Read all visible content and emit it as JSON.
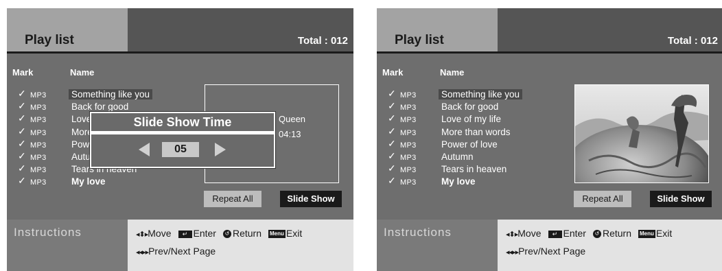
{
  "screens": [
    {
      "title": "Play list",
      "total": "Total : 012",
      "columns": {
        "mark": "Mark",
        "name": "Name"
      },
      "tracks": [
        {
          "format": "MP3",
          "name": "Something like you"
        },
        {
          "format": "MP3",
          "name": "Back for good"
        },
        {
          "format": "MP3",
          "name": "Love of my life"
        },
        {
          "format": "MP3",
          "name": "More than words"
        },
        {
          "format": "MP3",
          "name": "Power of love"
        },
        {
          "format": "MP3",
          "name": "Autumn"
        },
        {
          "format": "MP3",
          "name": "Tears in heaven"
        },
        {
          "format": "MP3",
          "name": "My love"
        }
      ],
      "info": {
        "artist": "Queen",
        "time": "04:13"
      },
      "buttons": {
        "repeat": "Repeat All",
        "slideshow": "Slide Show"
      },
      "instructions": {
        "label": "Instructions",
        "move": "Move",
        "enter": "Enter",
        "return": "Return",
        "menu_key": "Menu",
        "exit": "Exit",
        "page": "Prev/Next Page"
      },
      "dialog": {
        "title": "Slide Show Time",
        "value": "05"
      }
    },
    {
      "title": "Play list",
      "total": "Total : 012",
      "columns": {
        "mark": "Mark",
        "name": "Name"
      },
      "tracks": [
        {
          "format": "MP3",
          "name": "Something like you"
        },
        {
          "format": "MP3",
          "name": "Back for good"
        },
        {
          "format": "MP3",
          "name": "Love of my life"
        },
        {
          "format": "MP3",
          "name": "More than words"
        },
        {
          "format": "MP3",
          "name": "Power of love"
        },
        {
          "format": "MP3",
          "name": "Autumn"
        },
        {
          "format": "MP3",
          "name": "Tears in heaven"
        },
        {
          "format": "MP3",
          "name": "My love"
        }
      ],
      "buttons": {
        "repeat": "Repeat All",
        "slideshow": "Slide Show"
      },
      "instructions": {
        "label": "Instructions",
        "move": "Move",
        "enter": "Enter",
        "return": "Return",
        "menu_key": "Menu",
        "exit": "Exit",
        "page": "Prev/Next Page"
      }
    }
  ],
  "colors": {
    "header_dark": "#555555",
    "header_tab": "#a3a3a3",
    "panel": "#6e6e6e",
    "instructions_box": "#e3e3e3",
    "selected_button": "#1a1a1a"
  },
  "icons": [
    "check-icon",
    "updown-arrows-icon",
    "enter-key-icon",
    "return-icon",
    "menu-key-icon",
    "prev-next-icon",
    "arrow-left-icon",
    "arrow-right-icon"
  ]
}
